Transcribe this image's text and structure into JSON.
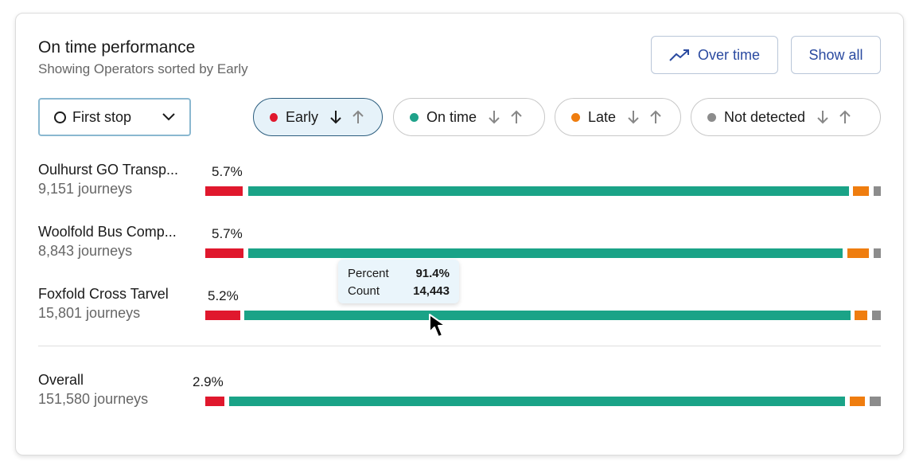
{
  "header": {
    "title": "On time performance",
    "subtitle": "Showing Operators sorted by Early",
    "over_time_label": "Over time",
    "show_all_label": "Show all"
  },
  "stop_select": {
    "value": "First stop"
  },
  "filters": [
    {
      "label": "Early",
      "color": "#e0182d",
      "active": true
    },
    {
      "label": "On time",
      "color": "#1fa28a",
      "active": false
    },
    {
      "label": "Late",
      "color": "#ef7d0f",
      "active": false
    },
    {
      "label": "Not detected",
      "color": "#8c8c8c",
      "active": false
    }
  ],
  "colors": {
    "early": "#e0182d",
    "on_time": "#1aa387",
    "late": "#ef7d0f",
    "not_detected": "#8c8c8c"
  },
  "rows": [
    {
      "name": "Oulhurst GO Transp...",
      "journeys": "9,151 journeys",
      "early_label": "5.7%"
    },
    {
      "name": "Woolfold Bus Comp...",
      "journeys": "8,843 journeys",
      "early_label": "5.7%"
    },
    {
      "name": "Foxfold Cross Tarvel",
      "journeys": "15,801 journeys",
      "early_label": "5.2%"
    }
  ],
  "overall": {
    "name": "Overall",
    "journeys": "151,580 journeys",
    "early_label": "2.9%"
  },
  "tooltip": {
    "percent_label": "Percent",
    "percent_value": "91.4%",
    "count_label": "Count",
    "count_value": "14,443"
  }
}
